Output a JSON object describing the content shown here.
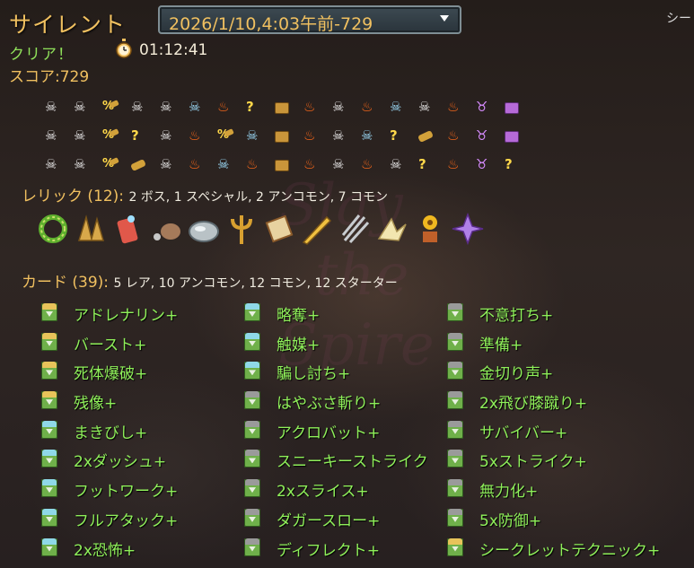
{
  "title": "サイレント",
  "run_select": {
    "value": "2026/1/10,4:03午前-729"
  },
  "language_label": "シー",
  "result": "クリア！",
  "timer": "01:12:41",
  "score": "スコア:729",
  "path_rows": [
    [
      "monster",
      "monster",
      "shop-mix",
      "monster",
      "monster",
      "elite",
      "rest",
      "unknown",
      "chest",
      "rest",
      "monster",
      "rest",
      "elite",
      "monster",
      "rest",
      "boss",
      "boss-chest"
    ],
    [
      "monster",
      "monster",
      "shop-mix",
      "unknown",
      "monster",
      "rest",
      "shop-mix",
      "elite",
      "chest",
      "rest",
      "monster",
      "elite",
      "unknown",
      "shop",
      "rest",
      "boss",
      "boss-chest"
    ],
    [
      "monster",
      "monster",
      "shop-mix",
      "shop",
      "monster",
      "rest",
      "elite",
      "rest",
      "chest",
      "rest",
      "monster",
      "rest",
      "monster",
      "unknown",
      "rest",
      "boss",
      "unknown"
    ]
  ],
  "relics_section": {
    "label": "レリック (12):",
    "summary": "2 ボス, 1 スペシャル, 2 アンコモン, 7 コモン"
  },
  "relics": [
    {
      "name": "serpent-ring-icon"
    },
    {
      "name": "leaf-fan-icon"
    },
    {
      "name": "charm-card-icon"
    },
    {
      "name": "ninja-scroll-icon"
    },
    {
      "name": "smooth-stone-icon"
    },
    {
      "name": "trident-icon"
    },
    {
      "name": "map-scroll-icon"
    },
    {
      "name": "quill-pen-icon"
    },
    {
      "name": "kunai-bundle-icon"
    },
    {
      "name": "paper-crane-icon"
    },
    {
      "name": "potted-flower-icon"
    },
    {
      "name": "shuriken-icon"
    }
  ],
  "cards_section": {
    "label": "カード (39):",
    "summary": "5 レア, 10 アンコモン, 12 コモン, 12 スターター"
  },
  "card_columns": [
    [
      {
        "name": "アドレナリン+",
        "rarity": "rare"
      },
      {
        "name": "バースト+",
        "rarity": "rare"
      },
      {
        "name": "死体爆破+",
        "rarity": "rare"
      },
      {
        "name": "残像+",
        "rarity": "rare"
      },
      {
        "name": "まきびし+",
        "rarity": "uncommon"
      },
      {
        "name": "2xダッシュ+",
        "rarity": "uncommon"
      },
      {
        "name": "フットワーク+",
        "rarity": "uncommon"
      },
      {
        "name": "フルアタック+",
        "rarity": "uncommon"
      },
      {
        "name": "2x恐怖+",
        "rarity": "uncommon"
      }
    ],
    [
      {
        "name": "略奪+",
        "rarity": "uncommon"
      },
      {
        "name": "触媒+",
        "rarity": "uncommon"
      },
      {
        "name": "騙し討ち+",
        "rarity": "uncommon"
      },
      {
        "name": "はやぶさ斬り+",
        "rarity": "common"
      },
      {
        "name": "アクロバット+",
        "rarity": "common"
      },
      {
        "name": "スニーキーストライク",
        "rarity": "common"
      },
      {
        "name": "2xスライス+",
        "rarity": "common"
      },
      {
        "name": "ダガースロー+",
        "rarity": "common"
      },
      {
        "name": "ディフレクト+",
        "rarity": "common"
      }
    ],
    [
      {
        "name": "不意打ち+",
        "rarity": "common"
      },
      {
        "name": "準備+",
        "rarity": "common"
      },
      {
        "name": "金切り声+",
        "rarity": "common"
      },
      {
        "name": "2x飛び膝蹴り+",
        "rarity": "common"
      },
      {
        "name": "サバイバー+",
        "rarity": "starter"
      },
      {
        "name": "5xストライク+",
        "rarity": "starter"
      },
      {
        "name": "無力化+",
        "rarity": "starter"
      },
      {
        "name": "5x防御+",
        "rarity": "starter"
      },
      {
        "name": "シークレットテクニック+",
        "rarity": "rare"
      }
    ]
  ],
  "colors": {
    "title": "#f0c060",
    "clear": "#8fe05a",
    "card_text": "#8ff05a",
    "rare": "#e8c35a",
    "uncommon": "#8fd8e8",
    "common": "#9a9a9a",
    "starter": "#9a9a9a"
  }
}
